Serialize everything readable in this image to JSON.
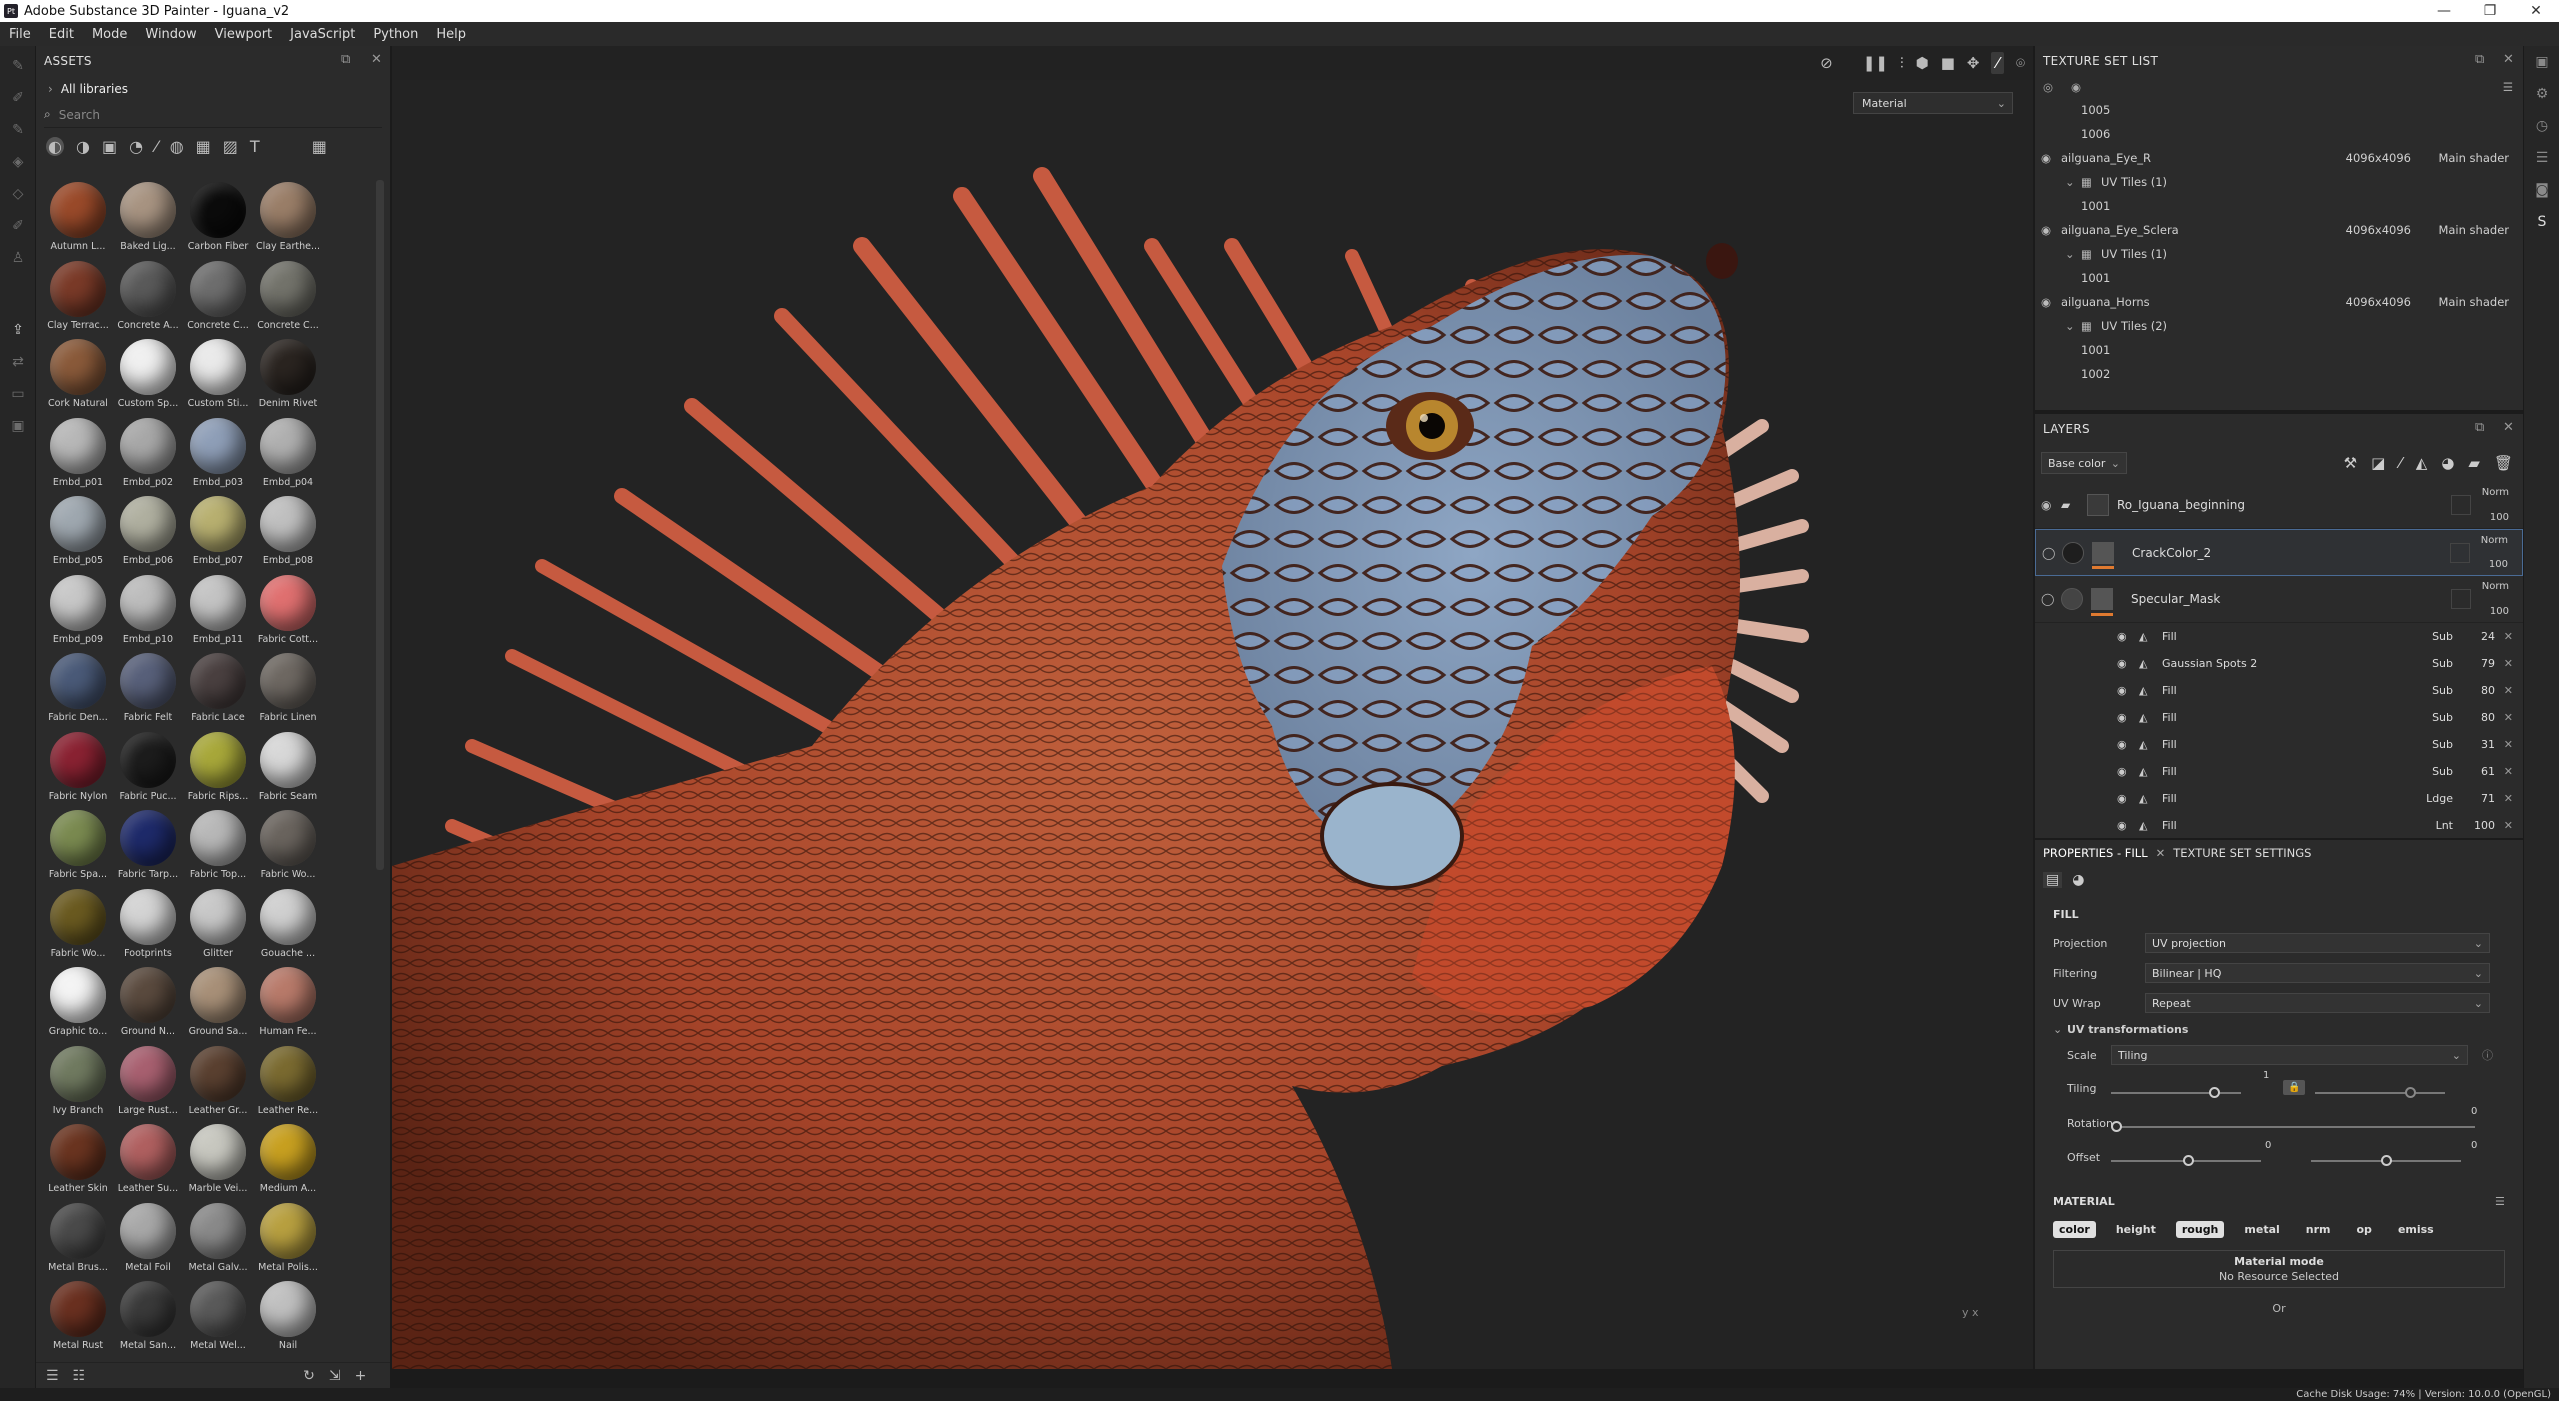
{
  "window": {
    "title": "Adobe Substance 3D Painter - Iguana_v2",
    "app_badge": "Pt"
  },
  "menu": [
    "File",
    "Edit",
    "Mode",
    "Window",
    "Viewport",
    "JavaScript",
    "Python",
    "Help"
  ],
  "assets": {
    "title": "ASSETS",
    "library": "All libraries",
    "search_placeholder": "Search",
    "items": [
      {
        "name": "Autumn L...",
        "color": "#9a4a2a"
      },
      {
        "name": "Baked Lig...",
        "color": "#a89482"
      },
      {
        "name": "Carbon Fiber",
        "color": "#0b0b0b"
      },
      {
        "name": "Clay Earthe...",
        "color": "#9a7e68"
      },
      {
        "name": "Clay Terrac...",
        "color": "#7a3a28"
      },
      {
        "name": "Concrete A...",
        "color": "#5a5a5a"
      },
      {
        "name": "Concrete C...",
        "color": "#6e6e6e"
      },
      {
        "name": "Concrete C...",
        "color": "#73736b"
      },
      {
        "name": "Cork Natural",
        "color": "#8a5a3a"
      },
      {
        "name": "Custom Sp...",
        "color": "#f0f0f0"
      },
      {
        "name": "Custom Sti...",
        "color": "#eaeaea"
      },
      {
        "name": "Denim Rivet",
        "color": "#2a2420"
      },
      {
        "name": "Embd_p01",
        "color": "#b8b8b8"
      },
      {
        "name": "Embd_p02",
        "color": "#a8a8a8"
      },
      {
        "name": "Embd_p03",
        "color": "#8f9fb8"
      },
      {
        "name": "Embd_p04",
        "color": "#b0b0b0"
      },
      {
        "name": "Embd_p05",
        "color": "#9fa8b0"
      },
      {
        "name": "Embd_p06",
        "color": "#b0b0a0"
      },
      {
        "name": "Embd_p07",
        "color": "#b8b070"
      },
      {
        "name": "Embd_p08",
        "color": "#c0c0c0"
      },
      {
        "name": "Embd_p09",
        "color": "#c8c8c8"
      },
      {
        "name": "Embd_p10",
        "color": "#bdbdbd"
      },
      {
        "name": "Embd_p11",
        "color": "#c4c4c4"
      },
      {
        "name": "Fabric Cott...",
        "color": "#e07070"
      },
      {
        "name": "Fabric Den...",
        "color": "#4a5a78"
      },
      {
        "name": "Fabric Felt",
        "color": "#58607a"
      },
      {
        "name": "Fabric Lace",
        "color": "#4a4040"
      },
      {
        "name": "Fabric Linen",
        "color": "#6e6862"
      },
      {
        "name": "Fabric Nylon",
        "color": "#8a2232"
      },
      {
        "name": "Fabric Puc...",
        "color": "#1c1c1c"
      },
      {
        "name": "Fabric Rips...",
        "color": "#a8a83a"
      },
      {
        "name": "Fabric Seam",
        "color": "#d8d8d8"
      },
      {
        "name": "Fabric Spa...",
        "color": "#7a8a50"
      },
      {
        "name": "Fabric Tarp...",
        "color": "#1e2a6a"
      },
      {
        "name": "Fabric Top...",
        "color": "#b8b8b8"
      },
      {
        "name": "Fabric Wo...",
        "color": "#6a645e"
      },
      {
        "name": "Fabric Wo...",
        "color": "#6a5a20"
      },
      {
        "name": "Footprints",
        "color": "#d4d4d4"
      },
      {
        "name": "Glitter",
        "color": "#c8c8c8"
      },
      {
        "name": "Gouache ...",
        "color": "#d0d0d0"
      },
      {
        "name": "Graphic to...",
        "color": "#f4f4f4"
      },
      {
        "name": "Ground N...",
        "color": "#5a4a3e"
      },
      {
        "name": "Ground Sa...",
        "color": "#a89078"
      },
      {
        "name": "Human Fe...",
        "color": "#b87a6a"
      },
      {
        "name": "Ivy Branch",
        "color": "#707a60"
      },
      {
        "name": "Large Rust...",
        "color": "#a86070"
      },
      {
        "name": "Leather Gr...",
        "color": "#5a4030"
      },
      {
        "name": "Leather Re...",
        "color": "#7a6a30"
      },
      {
        "name": "Leather Skin",
        "color": "#6a3420"
      },
      {
        "name": "Leather Su...",
        "color": "#b06060"
      },
      {
        "name": "Marble Vei...",
        "color": "#c8c8c0"
      },
      {
        "name": "Medium A...",
        "color": "#c8a020"
      },
      {
        "name": "Metal Brus...",
        "color": "#4a4a4a"
      },
      {
        "name": "Metal Foil",
        "color": "#a8a8a8"
      },
      {
        "name": "Metal Galv...",
        "color": "#8a8a8a"
      },
      {
        "name": "Metal Polis...",
        "color": "#b8a040"
      },
      {
        "name": "Metal Rust",
        "color": "#6a3020"
      },
      {
        "name": "Metal San...",
        "color": "#3a3a3a"
      },
      {
        "name": "Metal Wel...",
        "color": "#5a5a5a"
      },
      {
        "name": "Nail",
        "color": "#c0c0c0"
      }
    ]
  },
  "viewport": {
    "material_select": "Material",
    "axis_label": "y  x"
  },
  "texture_set_list": {
    "title": "TEXTURE SET LIST",
    "rows": [
      {
        "text": "1005",
        "kind": "tile"
      },
      {
        "text": "1006",
        "kind": "tile"
      },
      {
        "text": "ailguana_Eye_R",
        "kind": "set",
        "res": "4096x4096",
        "shader": "Main shader"
      },
      {
        "text": "UV Tiles (1)",
        "kind": "group"
      },
      {
        "text": "1001",
        "kind": "tile"
      },
      {
        "text": "ailguana_Eye_Sclera",
        "kind": "set",
        "res": "4096x4096",
        "shader": "Main shader"
      },
      {
        "text": "UV Tiles (1)",
        "kind": "group"
      },
      {
        "text": "1001",
        "kind": "tile"
      },
      {
        "text": "ailguana_Horns",
        "kind": "set",
        "res": "4096x4096",
        "shader": "Main shader"
      },
      {
        "text": "UV Tiles (2)",
        "kind": "group"
      },
      {
        "text": "1001",
        "kind": "tile"
      },
      {
        "text": "1002",
        "kind": "tile"
      }
    ]
  },
  "layers": {
    "title": "LAYERS",
    "channel": "Base color",
    "main": [
      {
        "name": "Ro_Iguana_beginning",
        "mode": "Norm",
        "opacity": "100"
      },
      {
        "name": "CrackColor_2",
        "mode": "Norm",
        "opacity": "100"
      },
      {
        "name": "Specular_Mask",
        "mode": "Norm",
        "opacity": "100"
      }
    ],
    "effects": [
      {
        "name": "Fill",
        "mode": "Sub",
        "val": "24"
      },
      {
        "name": "Gaussian Spots 2",
        "mode": "Sub",
        "val": "79"
      },
      {
        "name": "Fill",
        "mode": "Sub",
        "val": "80"
      },
      {
        "name": "Fill",
        "mode": "Sub",
        "val": "80"
      },
      {
        "name": "Fill",
        "mode": "Sub",
        "val": "31"
      },
      {
        "name": "Fill",
        "mode": "Sub",
        "val": "61"
      },
      {
        "name": "Fill",
        "mode": "Ldge",
        "val": "71"
      },
      {
        "name": "Fill",
        "mode": "Lnt",
        "val": "100"
      }
    ]
  },
  "properties": {
    "tab1": "PROPERTIES - FILL",
    "tab2": "TEXTURE SET SETTINGS",
    "fill_title": "FILL",
    "projection_label": "Projection",
    "projection": "UV projection",
    "filtering_label": "Filtering",
    "filtering": "Bilinear | HQ",
    "wrap_label": "UV Wrap",
    "wrap": "Repeat",
    "uvt_title": "UV transformations",
    "scale_label": "Scale",
    "scale": "Tiling",
    "tiling_label": "Tiling",
    "tiling_value": "1",
    "rotation_label": "Rotation",
    "rotation_value": "0",
    "offset_label": "Offset",
    "offset_x": "0",
    "offset_y": "0",
    "material_title": "MATERIAL",
    "channels": [
      {
        "label": "color",
        "on": true
      },
      {
        "label": "height",
        "on": false
      },
      {
        "label": "rough",
        "on": true
      },
      {
        "label": "metal",
        "on": false
      },
      {
        "label": "nrm",
        "on": false
      },
      {
        "label": "op",
        "on": false
      },
      {
        "label": "emiss",
        "on": false
      }
    ],
    "material_mode": "Material mode",
    "no_resource": "No Resource Selected",
    "or_text": "Or"
  },
  "status": "Cache Disk Usage:   74% | Version: 10.0.0 (OpenGL)"
}
